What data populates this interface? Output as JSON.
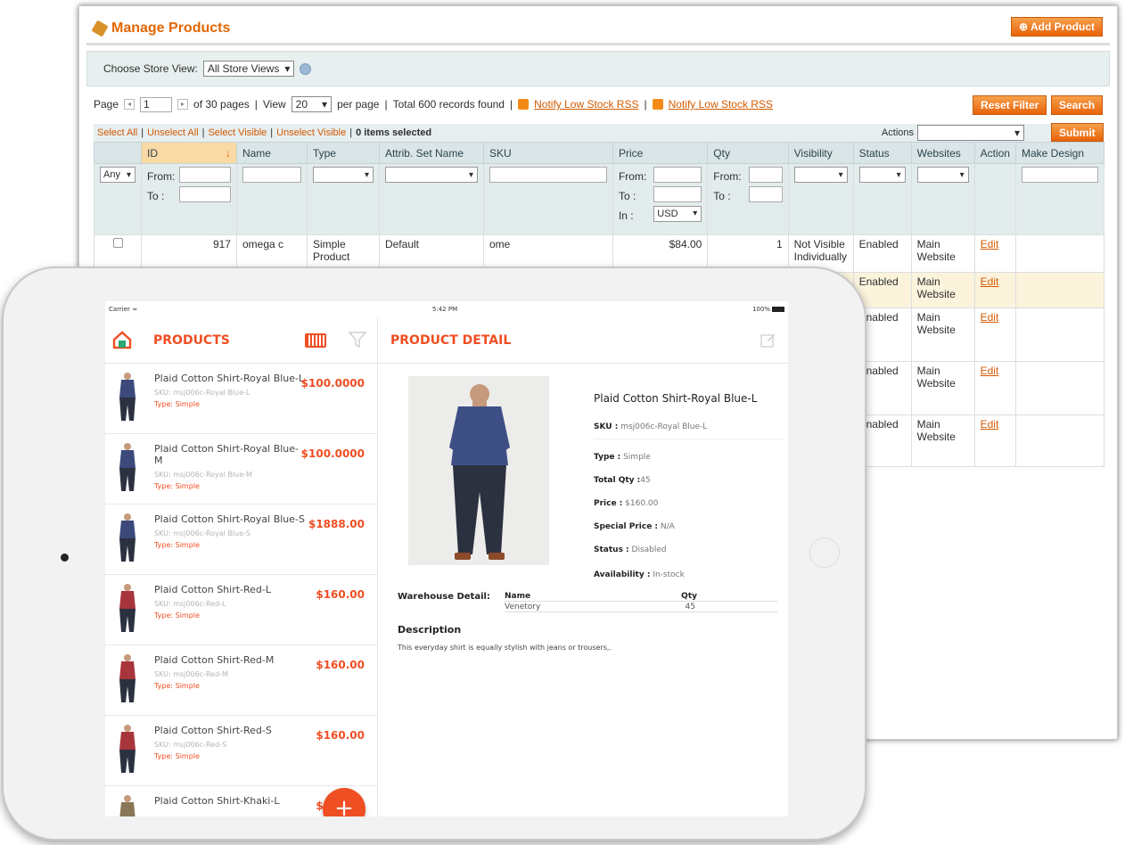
{
  "admin": {
    "title": "Manage Products",
    "add_button": "Add Product",
    "store_view_label": "Choose Store View:",
    "store_view_value": "All Store Views",
    "pager": {
      "page_label": "Page",
      "page_value": "1",
      "of_pages": "of 30 pages",
      "view_label": "View",
      "per_page_value": "20",
      "per_page_label": "per page",
      "total": "Total 600 records found",
      "rss1": "Notify Low Stock RSS",
      "rss2": "Notify Low Stock RSS"
    },
    "reset_filter": "Reset Filter",
    "search": "Search",
    "mass": {
      "select_all": "Select All",
      "unselect_all": "Unselect All",
      "select_visible": "Select Visible",
      "unselect_visible": "Unselect Visible",
      "selected": "0 items selected",
      "actions_label": "Actions",
      "submit": "Submit"
    },
    "columns": [
      "",
      "ID",
      "Name",
      "Type",
      "Attrib. Set Name",
      "SKU",
      "Price",
      "Qty",
      "Visibility",
      "Status",
      "Websites",
      "Action",
      "Make Design"
    ],
    "filter": {
      "any": "Any",
      "from": "From:",
      "to": "To :",
      "in": "In :",
      "currency": "USD"
    },
    "rows": [
      {
        "id": "917",
        "name": "omega c",
        "type": "Simple Product",
        "attrib": "Default",
        "sku": "ome",
        "price": "$84.00",
        "qty": "1",
        "visibility": "Not Visible Individually",
        "status": "Enabled",
        "websites": "Main Website",
        "action": "Edit"
      },
      {
        "status": "Enabled",
        "websites": "Main Website",
        "action": "Edit"
      },
      {
        "status": "Enabled",
        "websites": "Main Website",
        "action": "Edit"
      },
      {
        "status": "Enabled",
        "websites": "Main Website",
        "action": "Edit"
      },
      {
        "status": "Enabled",
        "websites": "Main Website",
        "action": "Edit"
      }
    ]
  },
  "tablet": {
    "carrier": "Carrier",
    "time": "5:42 PM",
    "battery": "100%",
    "products_title": "PRODUCTS",
    "detail_title": "PRODUCT DETAIL",
    "products": [
      {
        "name": "Plaid Cotton Shirt-Royal Blue-L",
        "sku": "SKU: msj006c-Royal Blue-L",
        "type": "Type: Simple",
        "price": "$100.0000",
        "color": "#3b4a7a"
      },
      {
        "name": "Plaid Cotton Shirt-Royal Blue-M",
        "sku": "SKU: msj006c-Royal Blue-M",
        "type": "Type: Simple",
        "price": "$100.0000",
        "color": "#3b4a7a"
      },
      {
        "name": "Plaid Cotton Shirt-Royal Blue-S",
        "sku": "SKU: msj006c-Royal Blue-S",
        "type": "Type: Simple",
        "price": "$1888.00",
        "color": "#3b4a7a"
      },
      {
        "name": "Plaid Cotton Shirt-Red-L",
        "sku": "SKU: msj006c-Red-L",
        "type": "Type: Simple",
        "price": "$160.00",
        "color": "#a8353b"
      },
      {
        "name": "Plaid Cotton Shirt-Red-M",
        "sku": "SKU: msj006c-Red-M",
        "type": "Type: Simple",
        "price": "$160.00",
        "color": "#a8353b"
      },
      {
        "name": "Plaid Cotton Shirt-Red-S",
        "sku": "SKU: msj006c-Red-S",
        "type": "Type: Simple",
        "price": "$160.00",
        "color": "#a8353b"
      },
      {
        "name": "Plaid Cotton Shirt-Khaki-L",
        "sku": "",
        "type": "",
        "price": "$160.00",
        "color": "#8a7657"
      }
    ],
    "detail": {
      "name": "Plaid Cotton Shirt-Royal Blue-L",
      "sku_label": "SKU :",
      "sku": "msj006c-Royal Blue-L",
      "type_label": "Type :",
      "type": "Simple",
      "qty_label": "Total Qty :",
      "qty": "45",
      "price_label": "Price :",
      "price": "$160.00",
      "special_label": "Special Price :",
      "special": "N/A",
      "status_label": "Status :",
      "status": "Disabled",
      "avail_label": "Availability :",
      "avail": "In-stock",
      "warehouse_label": "Warehouse Detail:",
      "wh_name_header": "Name",
      "wh_qty_header": "Qty",
      "wh_name": "Venetory",
      "wh_qty": "45",
      "description_label": "Description",
      "description": "This everyday shirt is equally stylish with jeans or trousers,."
    }
  },
  "colors": {
    "accent": "#f04e23",
    "admin_orange": "#e26703"
  }
}
